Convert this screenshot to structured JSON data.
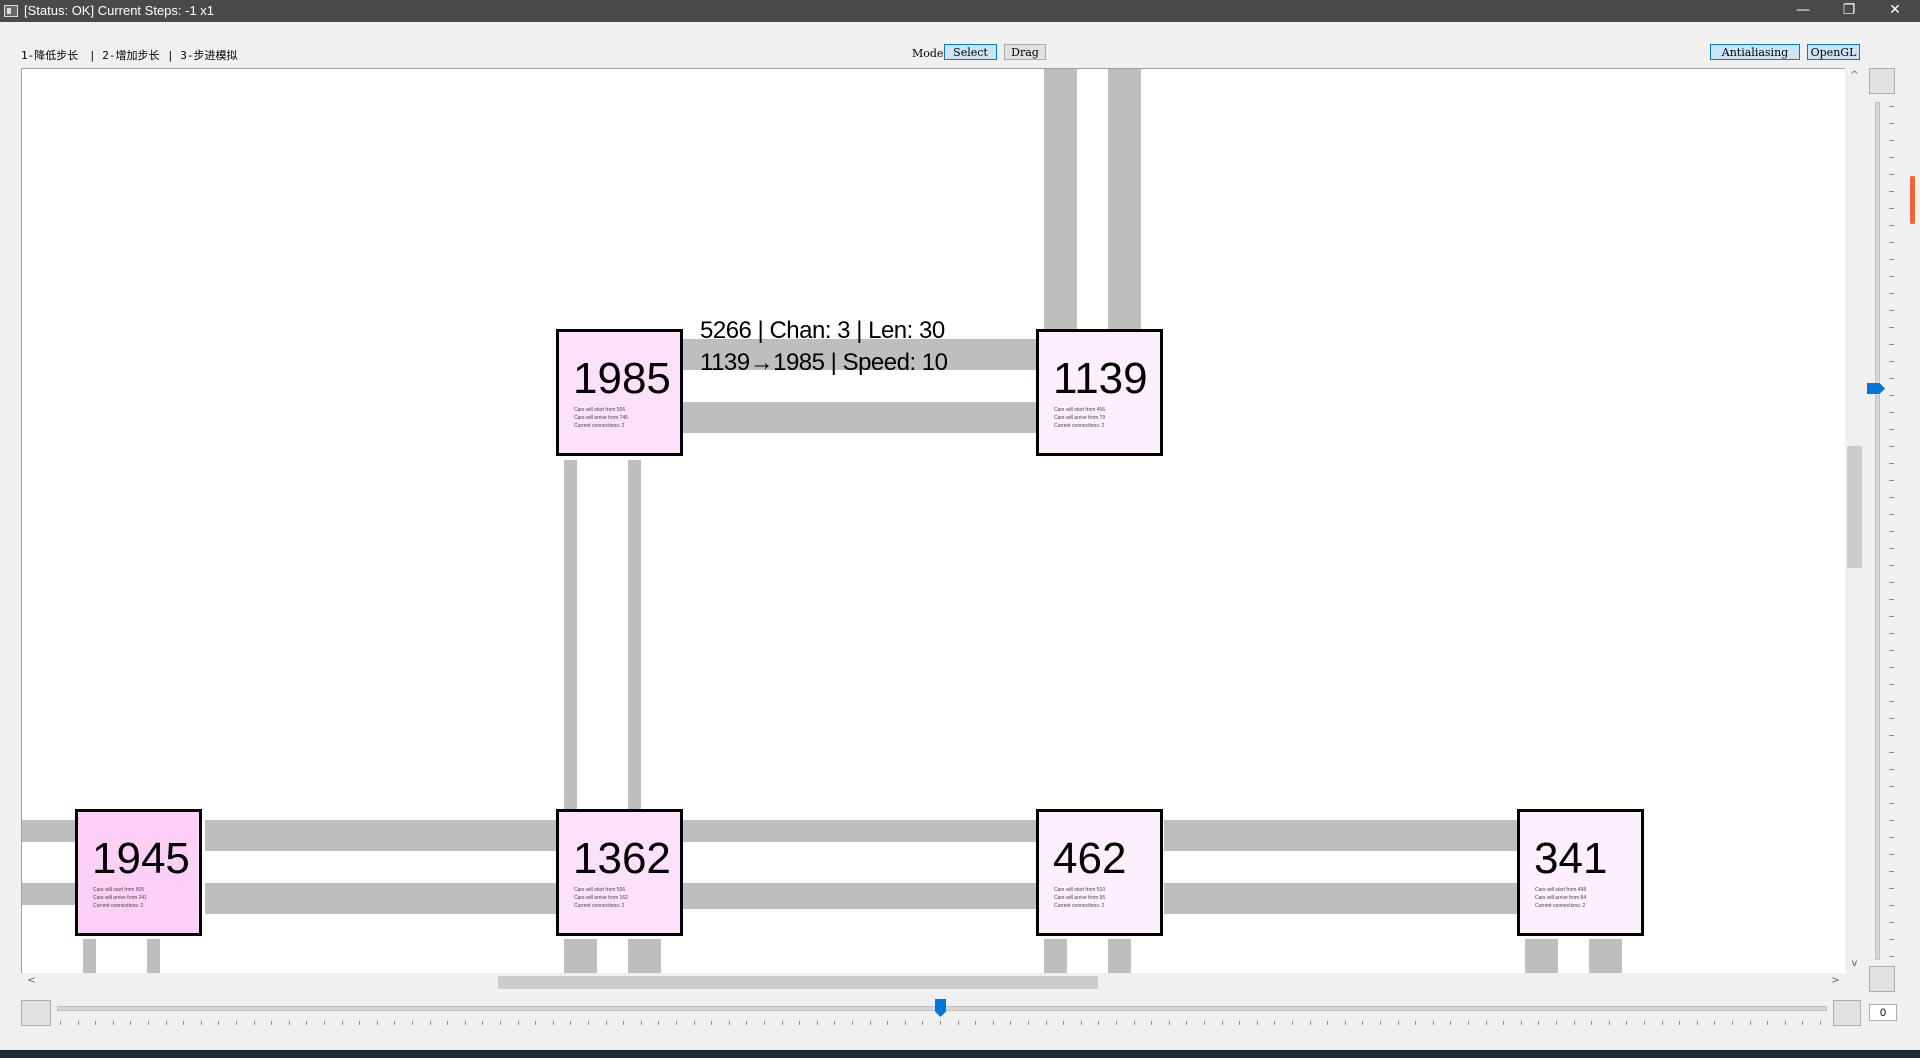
{
  "window": {
    "title": "[Status: OK] Current Steps: -1  x1",
    "controls": {
      "minimize": "—",
      "restore": "❐",
      "close": "✕"
    }
  },
  "toolbar": {
    "hints": [
      "1-降低步长",
      "| 2-增加步长",
      "| 3-步进模拟"
    ],
    "mode_label": "Mode",
    "mode_buttons": [
      "Select",
      "Drag"
    ],
    "mode_selected": "Select",
    "render_buttons": [
      "Antialiasing",
      "OpenGL"
    ]
  },
  "canvas": {
    "nodes": [
      {
        "id": "1985",
        "info": [
          "Cars will start from 506",
          "Cars will arrive from 745",
          "Current connections: 2"
        ],
        "color": "#fde0fa"
      },
      {
        "id": "1139",
        "info": [
          "Cars will start from 456",
          "Cars will arrive from 79",
          "Current connections: 2"
        ],
        "color": "#fdf0fc"
      },
      {
        "id": "1945",
        "info": [
          "Cars will start from 505",
          "Cars will arrive from 241",
          "Current connections: 2"
        ],
        "color": "#fdd0f8"
      },
      {
        "id": "1362",
        "info": [
          "Cars will start from 506",
          "Cars will arrive from 162",
          "Current connections: 2"
        ],
        "color": "#fde0fa"
      },
      {
        "id": "462",
        "info": [
          "Cars will start from 510",
          "Cars will arrive from 95",
          "Current connections: 2"
        ],
        "color": "#fdf0fc"
      },
      {
        "id": "341",
        "info": [
          "Cars will start from 498",
          "Cars will arrive from 84",
          "Current connections: 2"
        ],
        "color": "#fdf0fc"
      }
    ],
    "road_tooltip": {
      "line1": "5266 |  Chan: 3 |  Len: 30",
      "line2": "1139→1985 |  Speed: 10"
    },
    "road_color": "#bebebe"
  },
  "scrollbars": {
    "left_arrow": "<",
    "right_arrow": ">",
    "up_arrow": "^",
    "down_arrow": "v"
  },
  "step_slider": {
    "value_fraction": 0.5
  },
  "zoom_slider": {
    "value_fraction": 0.33
  },
  "spinbox": {
    "value": "0"
  },
  "colors": {
    "accent": "#0078d7",
    "titlebar": "#4a4a4a"
  }
}
